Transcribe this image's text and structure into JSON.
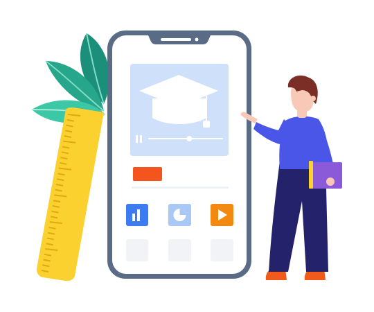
{
  "illustration": {
    "subject": "online-education-mobile-app",
    "colors": {
      "phone_frame": "#5a6b86",
      "screen_bg": "#ffffff",
      "video_panel": "#cfe0fb",
      "cap_color": "#ffffff",
      "accent_orange": "#f4541e",
      "accent_blue": "#3d7bf0",
      "light_blue": "#a9c8f5",
      "orange_play": "#f28a12",
      "tile_gray": "#f1f3f6",
      "ruler": "#fbd12f",
      "leaf_dark": "#1c8f7a",
      "leaf_light": "#3cc7a6",
      "shirt": "#4a56e8",
      "pants": "#24226a",
      "hair": "#7a2e26",
      "skin": "#f7c9b6",
      "shoes": "#f05a1a",
      "book": "#8a5ad8"
    },
    "icons": [
      "graduation-cap-icon",
      "pause-icon",
      "bar-chart-icon",
      "pie-chart-icon",
      "play-icon"
    ],
    "video_progress": 0.55
  }
}
